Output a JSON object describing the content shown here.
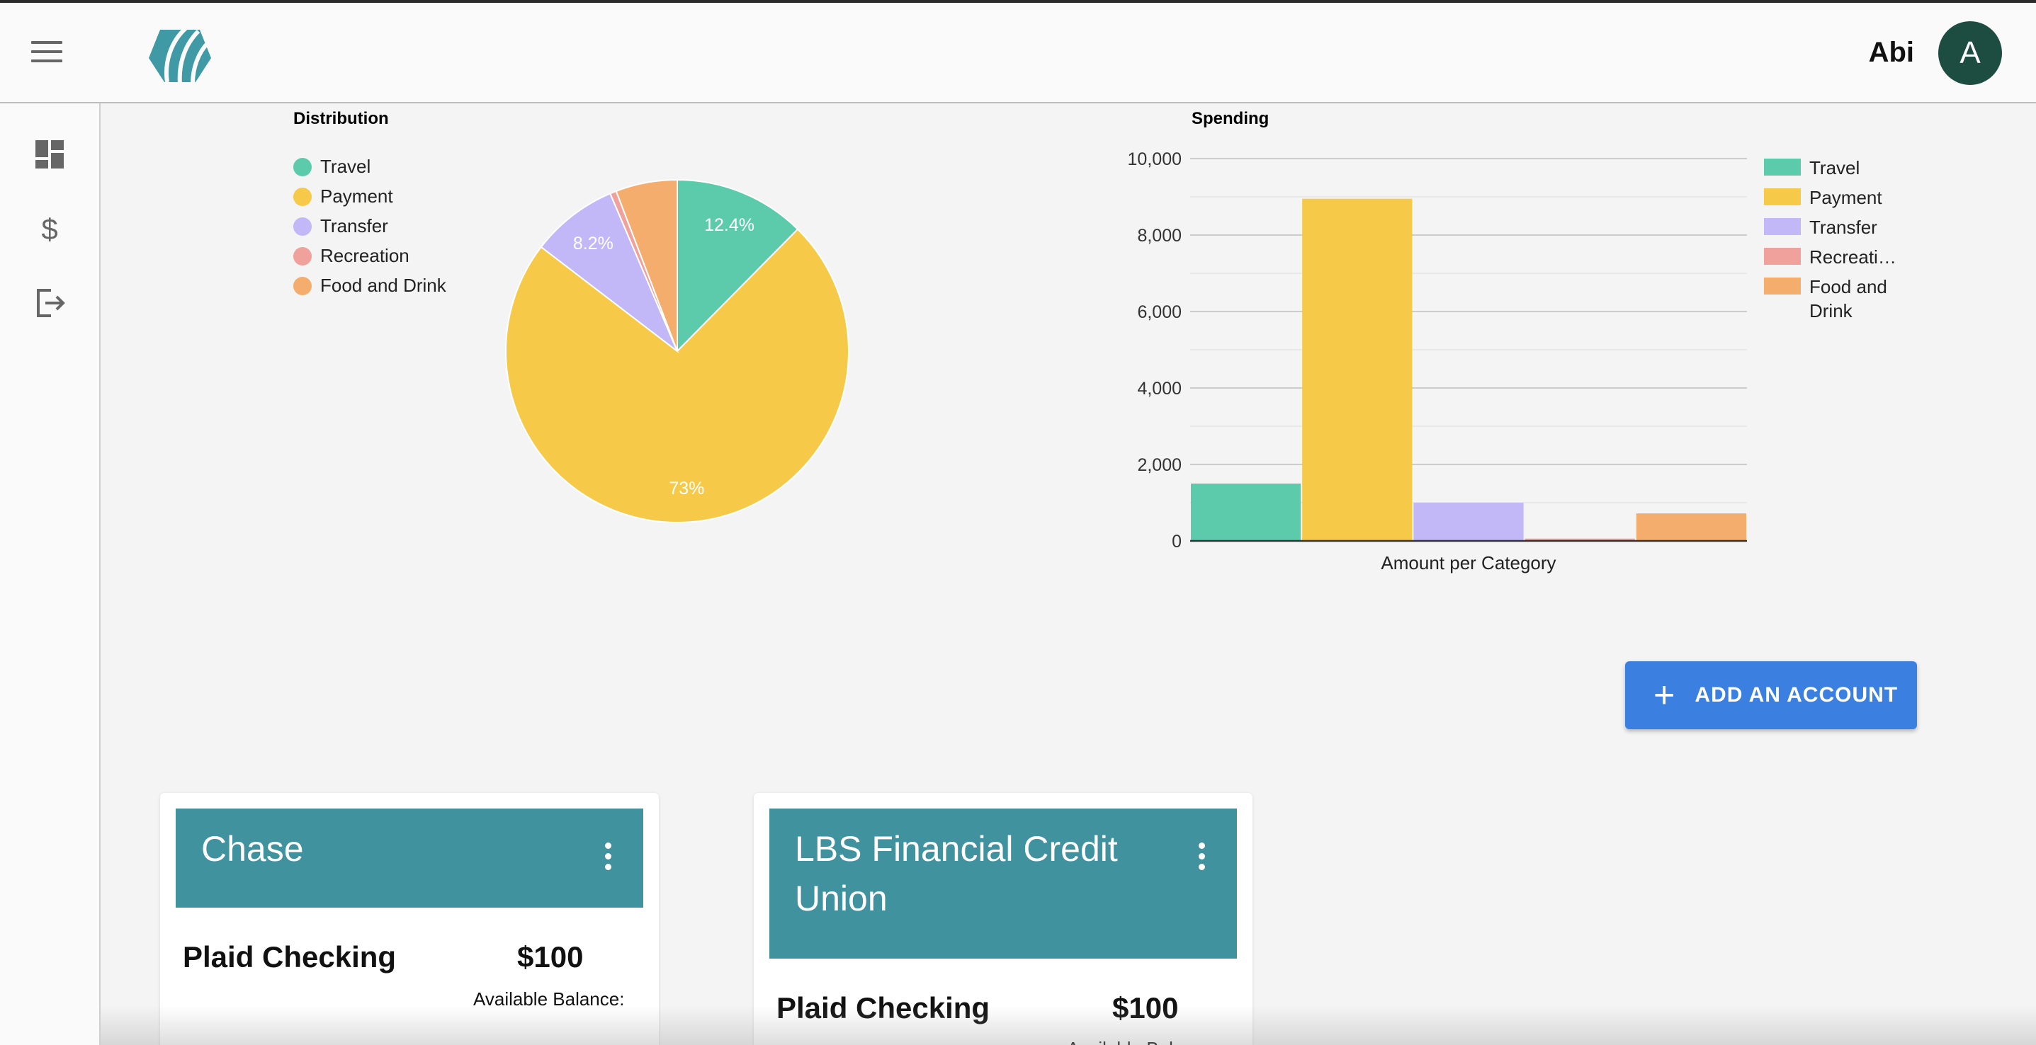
{
  "header": {
    "user_name": "Abi",
    "avatar_initial": "A"
  },
  "sidebar": {
    "items": [
      {
        "icon": "dashboard-icon"
      },
      {
        "icon": "dollar-icon"
      },
      {
        "icon": "logout-icon"
      }
    ]
  },
  "colors": {
    "travel": "#5ccbac",
    "payment": "#f7c948",
    "transfer": "#c2b8f8",
    "recreation": "#f0a19c",
    "food": "#f4ad6c",
    "accent": "#40929f",
    "button": "#3b7fe0"
  },
  "chart_data": [
    {
      "type": "pie",
      "title": "Distribution",
      "categories": [
        "Travel",
        "Payment",
        "Transfer",
        "Recreation",
        "Food and Drink"
      ],
      "values": [
        12.4,
        73,
        8.2,
        0.6,
        5.8
      ],
      "data_labels": [
        "12.4%",
        "73%",
        "8.2%",
        "",
        ""
      ],
      "legend": "left"
    },
    {
      "type": "bar",
      "title": "Spending",
      "xlabel": "Amount per Category",
      "ylabel": "",
      "categories": [
        "Travel",
        "Payment",
        "Transfer",
        "Recreation",
        "Food and Drink"
      ],
      "legend_labels": [
        "Travel",
        "Payment",
        "Transfer",
        "Recreati…",
        "Food and Drink"
      ],
      "values": [
        1500,
        8950,
        1000,
        60,
        720
      ],
      "ylim": [
        0,
        10000
      ],
      "yticks": [
        0,
        2000,
        4000,
        6000,
        8000,
        10000
      ],
      "ytick_labels": [
        "0",
        "2,000",
        "4,000",
        "6,000",
        "8,000",
        "10,000"
      ],
      "grid": true,
      "legend": "right"
    }
  ],
  "actions": {
    "add_account_label": "ADD AN ACCOUNT"
  },
  "accounts": [
    {
      "bank": "Chase",
      "account_name": "Plaid Checking",
      "amount": "$100",
      "balance_label": "Available Balance:"
    },
    {
      "bank": "LBS Financial Credit Union",
      "account_name": "Plaid Checking",
      "amount": "$100",
      "balance_label": "Available Balance:"
    }
  ]
}
